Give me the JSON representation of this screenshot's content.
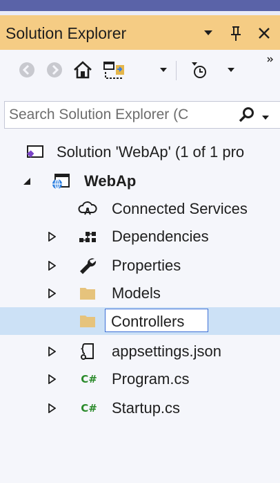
{
  "panel": {
    "title": "Solution Explorer"
  },
  "search": {
    "placeholder": "Search Solution Explorer (C"
  },
  "tree": {
    "solution": "Solution 'WebAp' (1 of 1 pro",
    "project": "WebAp",
    "items": [
      {
        "label": "Connected Services",
        "icon": "connected-services-icon"
      },
      {
        "label": "Dependencies",
        "icon": "dependencies-icon"
      },
      {
        "label": "Properties",
        "icon": "wrench-icon"
      },
      {
        "label": "Models",
        "icon": "folder-icon"
      },
      {
        "label": "Controllers",
        "icon": "folder-icon",
        "editing": true
      },
      {
        "label": "appsettings.json",
        "icon": "json-file-icon"
      },
      {
        "label": "Program.cs",
        "icon": "csharp-icon"
      },
      {
        "label": "Startup.cs",
        "icon": "csharp-icon"
      }
    ],
    "csharp_glyph": "C#"
  },
  "colors": {
    "title_bar": "#f5cc84",
    "selection": "#cce1f6",
    "edit_border": "#3c6fd6",
    "csharp": "#2a8a2a"
  }
}
